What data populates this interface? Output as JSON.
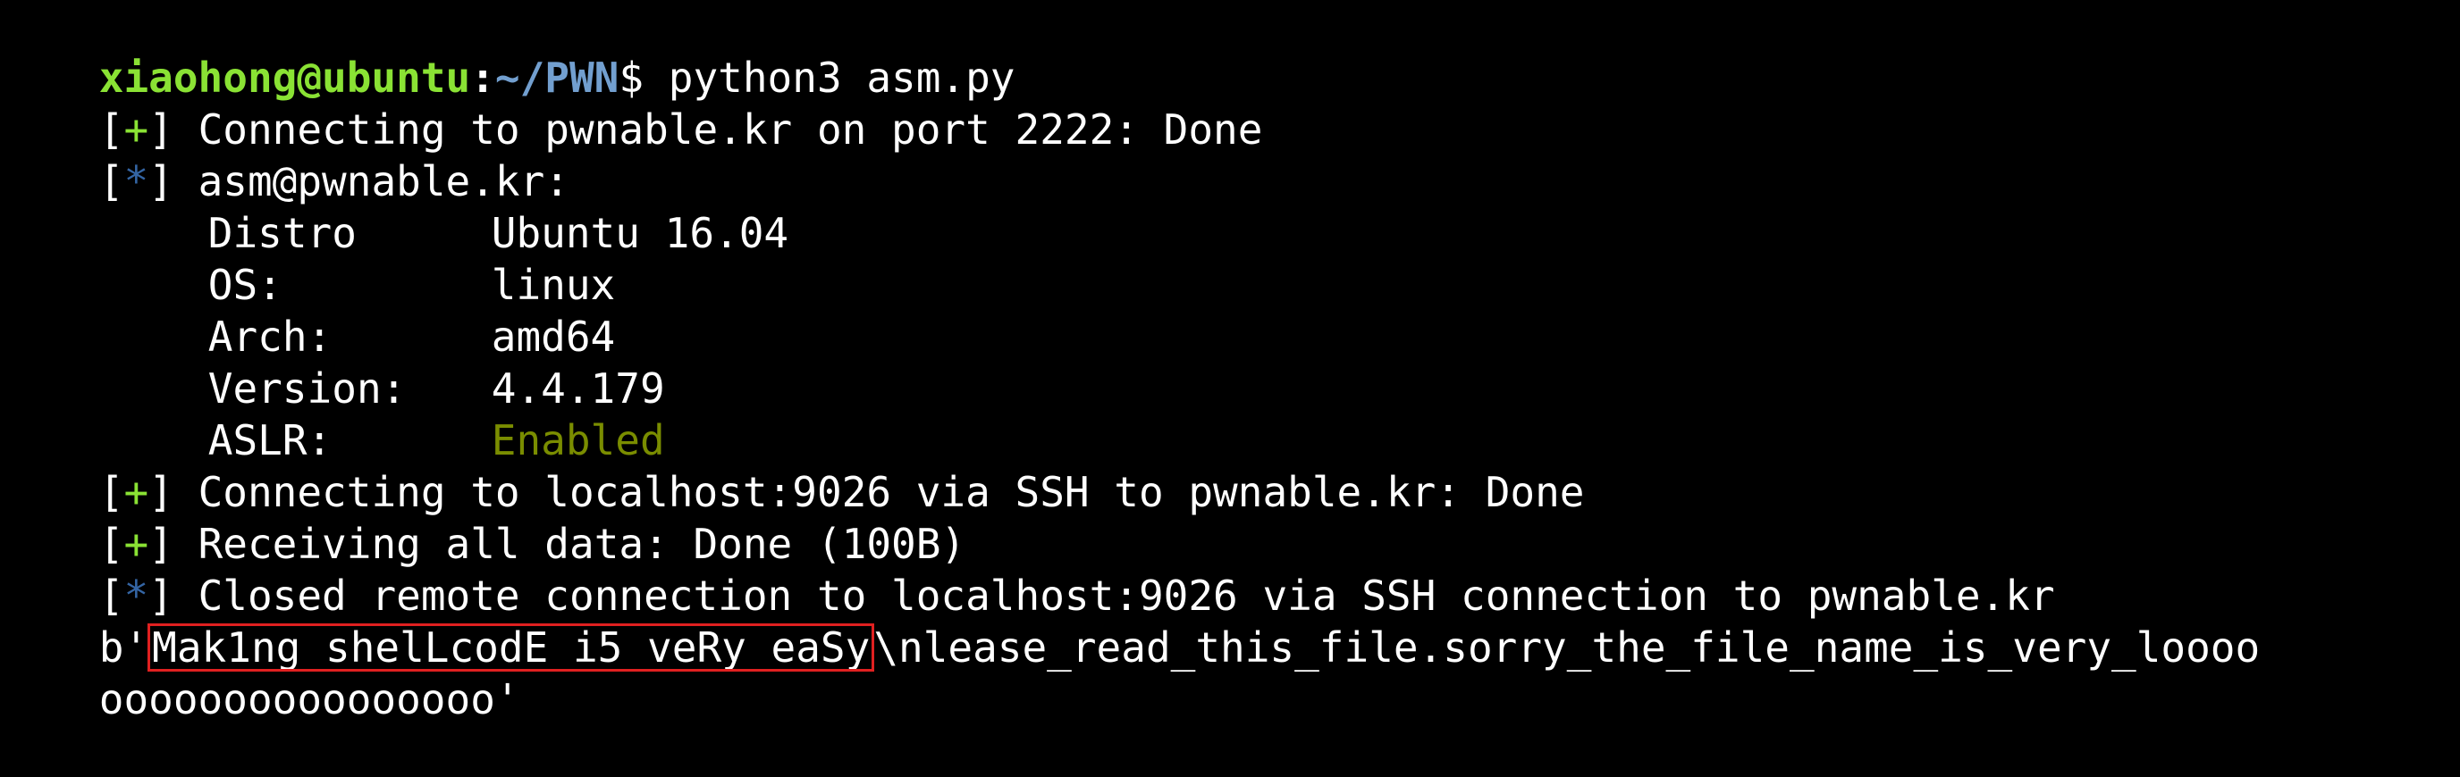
{
  "prompt": {
    "user": "xiaohong@ubuntu",
    "colon": ":",
    "path": "~/PWN",
    "suffix": "$ ",
    "command": "python3 asm.py"
  },
  "marks": {
    "plus": "+",
    "star": "*",
    "open": "[",
    "close": "]"
  },
  "lines": {
    "connect_ssh": " Connecting to pwnable.kr on port 2222: Done",
    "host": " asm@pwnable.kr:",
    "connect_local": " Connecting to localhost:9026 via SSH to pwnable.kr: Done",
    "receiving": " Receiving all data: Done (100B)",
    "closed": " Closed remote connection to localhost:9026 via SSH connection to pwnable.kr"
  },
  "host_info": {
    "distro_key": "Distro",
    "distro_val": "Ubuntu 16.04",
    "os_key": "OS:",
    "os_val": "linux",
    "arch_key": "Arch:",
    "arch_val": "amd64",
    "version_key": "Version:",
    "version_val": "4.4.179",
    "aslr_key": "ASLR:",
    "aslr_val": "Enabled"
  },
  "output": {
    "prefix": "b'",
    "flag": "Mak1ng_shelLcodE_i5_veRy_eaSy",
    "rest": "\\nlease_read_this_file.sorry_the_file_name_is_very_loooo",
    "line2": "oooooooooooooooo'"
  },
  "colors": {
    "background": "#000000",
    "user": "#8ae234",
    "path": "#729fcf",
    "plus": "#8ae234",
    "star": "#3465a4",
    "enabled": "#7a8d00",
    "highlight_box": "#e02020"
  }
}
